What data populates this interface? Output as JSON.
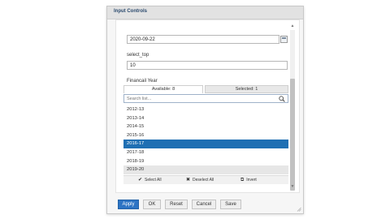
{
  "dialog": {
    "title": "Input Controls"
  },
  "date_field": {
    "value": "2020-09-22"
  },
  "select_top": {
    "label": "select_top",
    "value": "10"
  },
  "financial_year": {
    "label": "Financail Year",
    "tab_available": "Available: 8",
    "tab_selected": "Selected: 1",
    "search_placeholder": "Search list...",
    "items": [
      "2012-13",
      "2013-14",
      "2014-15",
      "2015-16",
      "2016-17",
      "2017-18",
      "2018-19",
      "2019-20"
    ],
    "selected_item": "2016-17",
    "actions": {
      "select_all": "Select All",
      "deselect_all": "Deselect All",
      "invert": "Invert"
    }
  },
  "footer": {
    "apply": "Apply",
    "ok": "OK",
    "reset": "Reset",
    "cancel": "Cancel",
    "save": "Save"
  },
  "colors": {
    "primary": "#2d74c4",
    "selection": "#1f6fb3",
    "title_text": "#2b4a6e"
  }
}
